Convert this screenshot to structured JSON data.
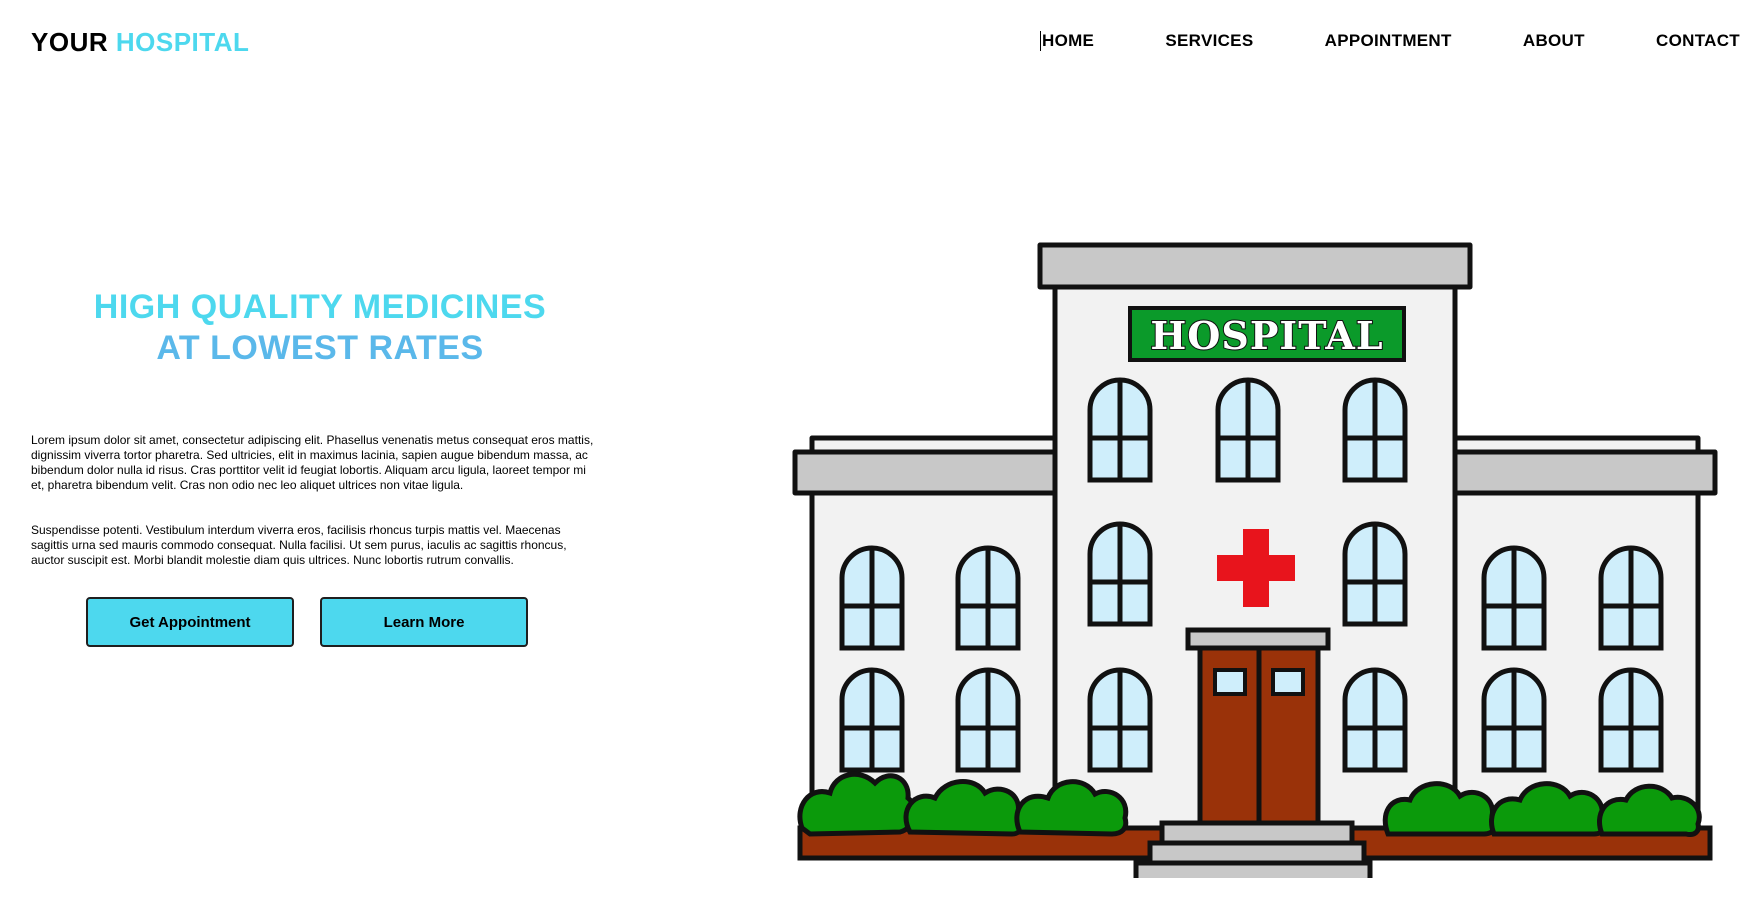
{
  "header": {
    "logo_part1": "YOUR",
    "logo_part2": "HOSPITAL",
    "nav": [
      "HOME",
      "SERVICES",
      "APPOINTMENT",
      "ABOUT",
      "CONTACT"
    ]
  },
  "hero": {
    "title_line1": "HIGH QUALITY MEDICINES",
    "title_line2": "AT LOWEST RATES",
    "paragraph1": "Lorem ipsum dolor sit amet, consectetur adipiscing elit. Phasellus venenatis metus consequat eros mattis, dignissim viverra tortor pharetra. Sed ultricies, elit in maximus lacinia, sapien augue bibendum massa, ac bibendum dolor nulla id risus. Cras porttitor velit id feugiat lobortis. Aliquam arcu ligula, laoreet tempor mi et, pharetra bibendum velit. Cras non odio nec leo aliquet ultrices non vitae ligula.",
    "paragraph2": "Suspendisse potenti. Vestibulum interdum viverra eros, facilisis rhoncus turpis mattis vel. Maecenas sagittis urna sed mauris commodo consequat. Nulla facilisi. Ut sem purus, iaculis ac sagittis rhoncus, auctor suscipit est. Morbi blandit molestie diam quis ultrices. Nunc lobortis rutrum convallis.",
    "button_primary": "Get Appointment",
    "button_secondary": "Learn More"
  },
  "illustration": {
    "sign_text": "HOSPITAL",
    "icon": "hospital-building-illustration"
  },
  "colors": {
    "accent_cyan": "#4dd8ee",
    "accent_blue": "#5ab8ea",
    "sign_green": "#0b9a2a",
    "cross_red": "#e8141c",
    "door_brown": "#9a3209",
    "bush_green": "#0b9a0b"
  }
}
